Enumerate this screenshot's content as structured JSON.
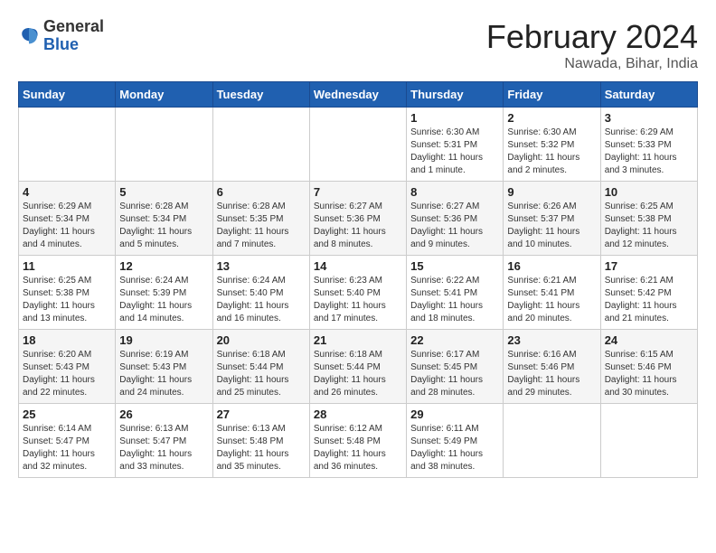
{
  "header": {
    "logo_line1": "General",
    "logo_line2": "Blue",
    "month_title": "February 2024",
    "location": "Nawada, Bihar, India"
  },
  "weekdays": [
    "Sunday",
    "Monday",
    "Tuesday",
    "Wednesday",
    "Thursday",
    "Friday",
    "Saturday"
  ],
  "weeks": [
    [
      {
        "day": "",
        "info": ""
      },
      {
        "day": "",
        "info": ""
      },
      {
        "day": "",
        "info": ""
      },
      {
        "day": "",
        "info": ""
      },
      {
        "day": "1",
        "info": "Sunrise: 6:30 AM\nSunset: 5:31 PM\nDaylight: 11 hours\nand 1 minute."
      },
      {
        "day": "2",
        "info": "Sunrise: 6:30 AM\nSunset: 5:32 PM\nDaylight: 11 hours\nand 2 minutes."
      },
      {
        "day": "3",
        "info": "Sunrise: 6:29 AM\nSunset: 5:33 PM\nDaylight: 11 hours\nand 3 minutes."
      }
    ],
    [
      {
        "day": "4",
        "info": "Sunrise: 6:29 AM\nSunset: 5:34 PM\nDaylight: 11 hours\nand 4 minutes."
      },
      {
        "day": "5",
        "info": "Sunrise: 6:28 AM\nSunset: 5:34 PM\nDaylight: 11 hours\nand 5 minutes."
      },
      {
        "day": "6",
        "info": "Sunrise: 6:28 AM\nSunset: 5:35 PM\nDaylight: 11 hours\nand 7 minutes."
      },
      {
        "day": "7",
        "info": "Sunrise: 6:27 AM\nSunset: 5:36 PM\nDaylight: 11 hours\nand 8 minutes."
      },
      {
        "day": "8",
        "info": "Sunrise: 6:27 AM\nSunset: 5:36 PM\nDaylight: 11 hours\nand 9 minutes."
      },
      {
        "day": "9",
        "info": "Sunrise: 6:26 AM\nSunset: 5:37 PM\nDaylight: 11 hours\nand 10 minutes."
      },
      {
        "day": "10",
        "info": "Sunrise: 6:25 AM\nSunset: 5:38 PM\nDaylight: 11 hours\nand 12 minutes."
      }
    ],
    [
      {
        "day": "11",
        "info": "Sunrise: 6:25 AM\nSunset: 5:38 PM\nDaylight: 11 hours\nand 13 minutes."
      },
      {
        "day": "12",
        "info": "Sunrise: 6:24 AM\nSunset: 5:39 PM\nDaylight: 11 hours\nand 14 minutes."
      },
      {
        "day": "13",
        "info": "Sunrise: 6:24 AM\nSunset: 5:40 PM\nDaylight: 11 hours\nand 16 minutes."
      },
      {
        "day": "14",
        "info": "Sunrise: 6:23 AM\nSunset: 5:40 PM\nDaylight: 11 hours\nand 17 minutes."
      },
      {
        "day": "15",
        "info": "Sunrise: 6:22 AM\nSunset: 5:41 PM\nDaylight: 11 hours\nand 18 minutes."
      },
      {
        "day": "16",
        "info": "Sunrise: 6:21 AM\nSunset: 5:41 PM\nDaylight: 11 hours\nand 20 minutes."
      },
      {
        "day": "17",
        "info": "Sunrise: 6:21 AM\nSunset: 5:42 PM\nDaylight: 11 hours\nand 21 minutes."
      }
    ],
    [
      {
        "day": "18",
        "info": "Sunrise: 6:20 AM\nSunset: 5:43 PM\nDaylight: 11 hours\nand 22 minutes."
      },
      {
        "day": "19",
        "info": "Sunrise: 6:19 AM\nSunset: 5:43 PM\nDaylight: 11 hours\nand 24 minutes."
      },
      {
        "day": "20",
        "info": "Sunrise: 6:18 AM\nSunset: 5:44 PM\nDaylight: 11 hours\nand 25 minutes."
      },
      {
        "day": "21",
        "info": "Sunrise: 6:18 AM\nSunset: 5:44 PM\nDaylight: 11 hours\nand 26 minutes."
      },
      {
        "day": "22",
        "info": "Sunrise: 6:17 AM\nSunset: 5:45 PM\nDaylight: 11 hours\nand 28 minutes."
      },
      {
        "day": "23",
        "info": "Sunrise: 6:16 AM\nSunset: 5:46 PM\nDaylight: 11 hours\nand 29 minutes."
      },
      {
        "day": "24",
        "info": "Sunrise: 6:15 AM\nSunset: 5:46 PM\nDaylight: 11 hours\nand 30 minutes."
      }
    ],
    [
      {
        "day": "25",
        "info": "Sunrise: 6:14 AM\nSunset: 5:47 PM\nDaylight: 11 hours\nand 32 minutes."
      },
      {
        "day": "26",
        "info": "Sunrise: 6:13 AM\nSunset: 5:47 PM\nDaylight: 11 hours\nand 33 minutes."
      },
      {
        "day": "27",
        "info": "Sunrise: 6:13 AM\nSunset: 5:48 PM\nDaylight: 11 hours\nand 35 minutes."
      },
      {
        "day": "28",
        "info": "Sunrise: 6:12 AM\nSunset: 5:48 PM\nDaylight: 11 hours\nand 36 minutes."
      },
      {
        "day": "29",
        "info": "Sunrise: 6:11 AM\nSunset: 5:49 PM\nDaylight: 11 hours\nand 38 minutes."
      },
      {
        "day": "",
        "info": ""
      },
      {
        "day": "",
        "info": ""
      }
    ]
  ]
}
